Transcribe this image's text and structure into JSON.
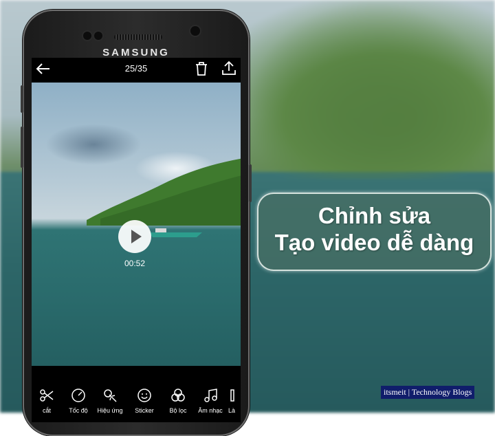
{
  "app": {
    "counter": "25/35",
    "duration": "00:52",
    "brand": "SAMSUNG"
  },
  "toolbar": [
    {
      "label": "cắt",
      "icon": "scissors-icon"
    },
    {
      "label": "Tốc độ",
      "icon": "speedometer-icon"
    },
    {
      "label": "Hiệu ứng",
      "icon": "magic-wand-icon"
    },
    {
      "label": "Sticker",
      "icon": "smiley-icon"
    },
    {
      "label": "Bộ lọc",
      "icon": "filter-circles-icon"
    },
    {
      "label": "Âm nhạc",
      "icon": "music-note-icon"
    },
    {
      "label": "Là",
      "icon": "partial-tool-icon"
    }
  ],
  "overlay": {
    "line1": "Chỉnh sửa",
    "line2": "Tạo video dễ dàng"
  },
  "watermark": "itsmeit | Technology Blogs",
  "colors": {
    "badge_bg": "#466e64",
    "watermark_bg": "#101d6b"
  }
}
